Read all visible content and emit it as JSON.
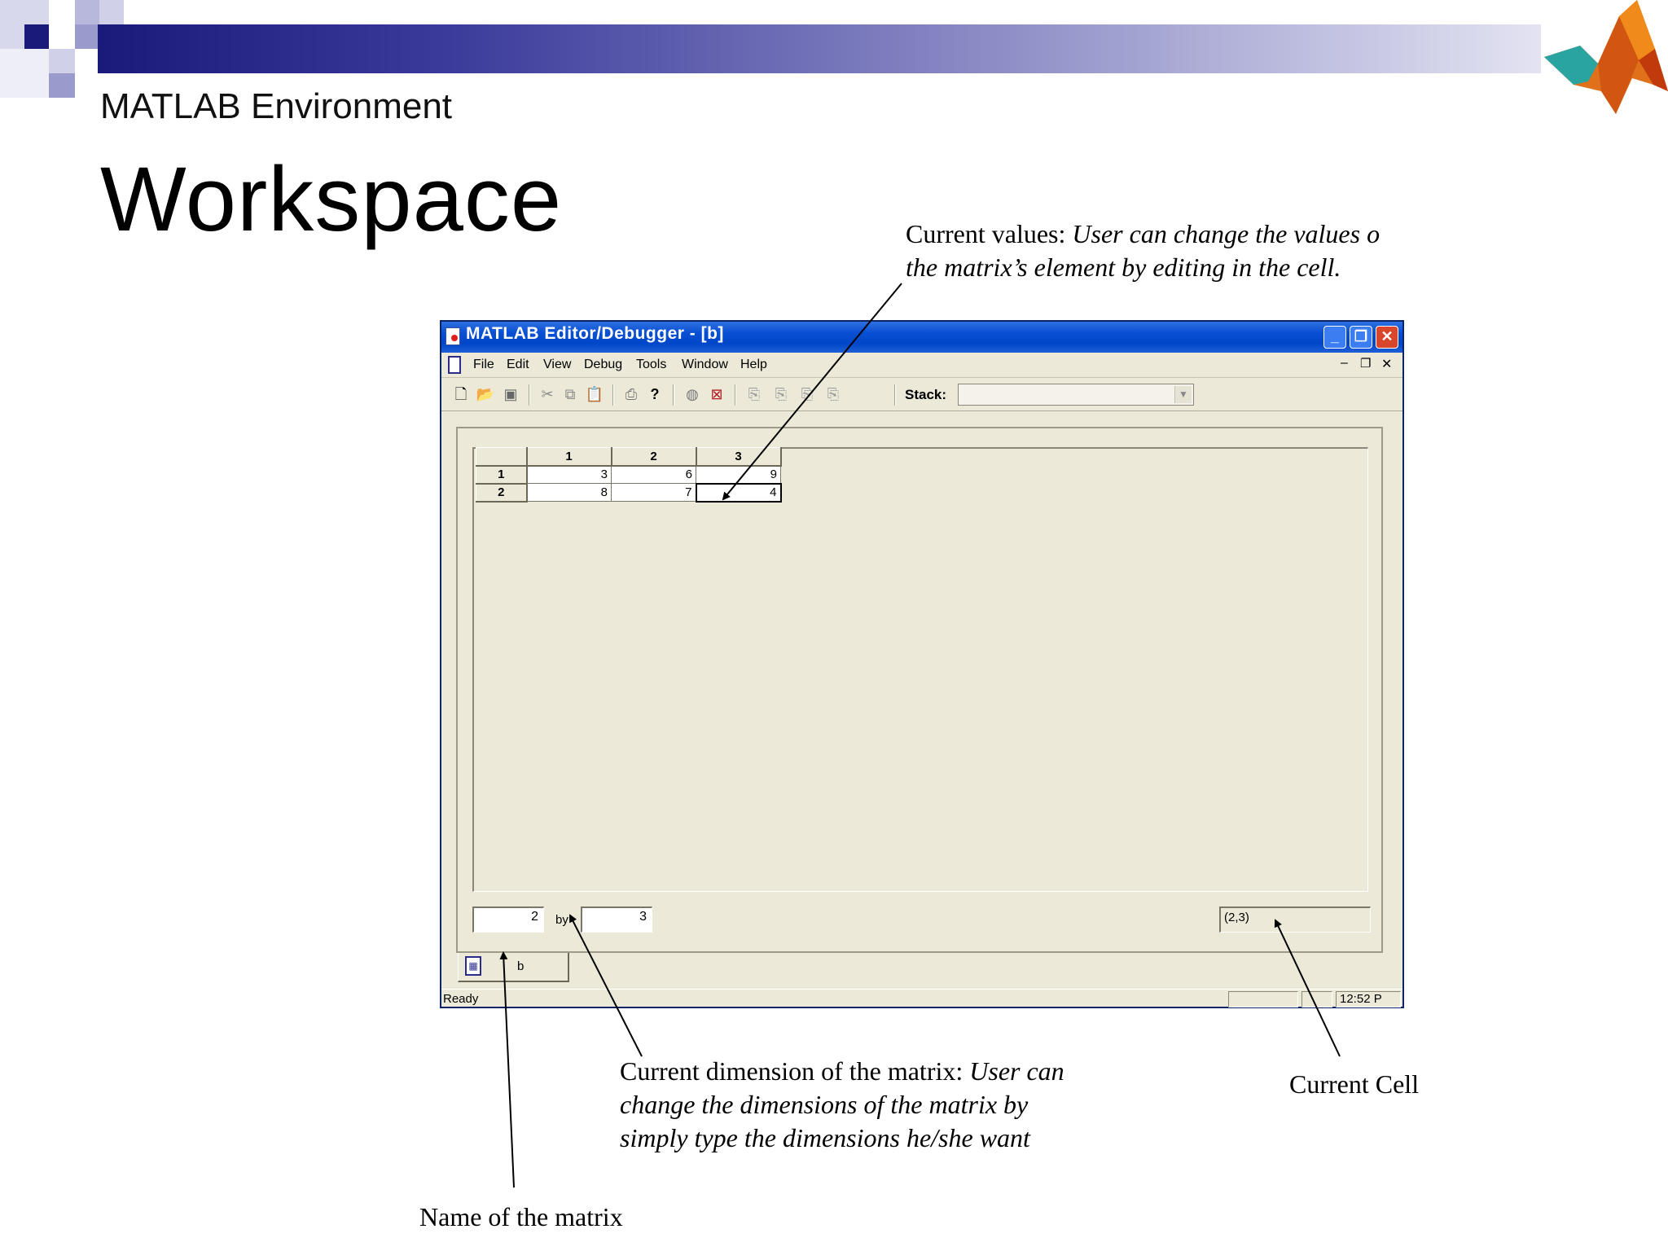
{
  "slide": {
    "kicker": "MATLAB Environment",
    "title": "Workspace"
  },
  "window": {
    "title": "MATLAB Editor/Debugger - [b]",
    "menu": [
      "File",
      "Edit",
      "View",
      "Debug",
      "Tools",
      "Window",
      "Help"
    ],
    "stack_label": "Stack:",
    "col_headers": [
      "1",
      "2",
      "3"
    ],
    "row_headers": [
      "1",
      "2"
    ],
    "cells": [
      [
        "3",
        "6",
        "9"
      ],
      [
        "8",
        "7",
        "4"
      ]
    ],
    "rows_value": "2",
    "by_label": "by",
    "cols_value": "3",
    "current_cell": "(2,3)",
    "tab_label": "b",
    "status": "Ready",
    "clock": "12:52  P"
  },
  "annotations": {
    "current_values_lead": "Current values: ",
    "current_values_italic_1": "User can change the values o",
    "current_values_italic_2": "the matrix’s element by editing in the cell.",
    "dimension_lead": "Current dimension of  the matrix: ",
    "dimension_italic_1": "User can",
    "dimension_italic_2": "change  the  dimensions  of  the  matrix  by",
    "dimension_italic_3": "simply type the dimensions he/she want",
    "current_cell": "Current Cell",
    "matrix_name": "Name of the matrix"
  },
  "colors": {
    "titlebar": "#0046c8",
    "window_bg": "#ece9d8",
    "header_gradient_dark": "#1a1a7a"
  },
  "icons": [
    "new-file-icon",
    "open-folder-icon",
    "save-icon",
    "cut-icon",
    "copy-icon",
    "paste-icon",
    "print-icon",
    "help-icon",
    "breakpoint-icon",
    "clear-breakpoints-icon",
    "step-icon",
    "step-in-icon",
    "step-out-icon",
    "continue-icon"
  ]
}
